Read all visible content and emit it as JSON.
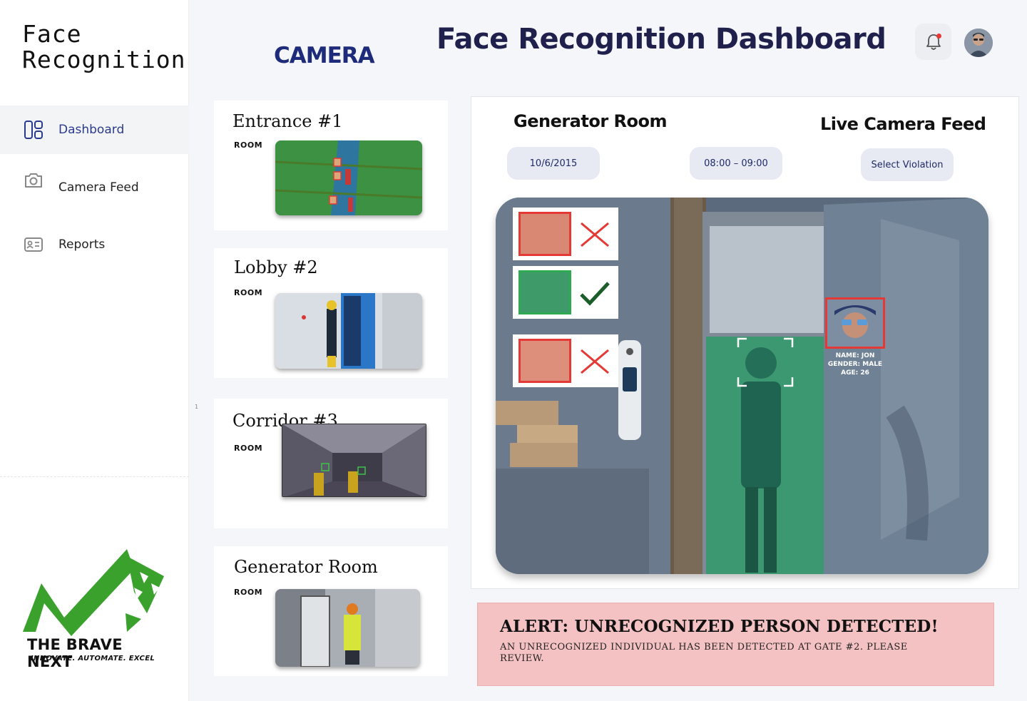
{
  "app": {
    "title_line1": "Face",
    "title_line2": "Recognition"
  },
  "sidebar": {
    "items": [
      {
        "label": "Dashboard",
        "icon": "dashboard-icon",
        "active": true
      },
      {
        "label": "Camera Feed",
        "icon": "camera-icon",
        "active": false
      },
      {
        "label": "Reports",
        "icon": "id-card-icon",
        "active": false
      }
    ],
    "stray_mark": "1",
    "logo": {
      "name": "THE BRAVE NEXT",
      "tagline": "INNOVATE. AUTOMATE. EXCEL",
      "color": "#3aa12c"
    }
  },
  "header": {
    "section": "CAMERA",
    "title": "Face Recognition Dashboard",
    "bell_icon": "bell-icon",
    "notification_dot_color": "#e53935"
  },
  "cameras": [
    {
      "name": "Entrance #1",
      "type": "ROOM"
    },
    {
      "name": "Lobby #2",
      "type": "ROOM"
    },
    {
      "name": "Corridor #3",
      "type": "ROOM"
    },
    {
      "name": "Generator Room",
      "type": "ROOM"
    }
  ],
  "live": {
    "room": "Generator Room",
    "heading": "Live Camera Feed",
    "date": "10/6/2015",
    "time_range": "08:00 – 09:00",
    "violation_select": "Select Violation",
    "detection": {
      "name_line": "NAME: JON",
      "gender_line": "GENDER: MALE",
      "age_line": "AGE: 26"
    },
    "face_checks": [
      "denied",
      "approved",
      "denied"
    ]
  },
  "alert": {
    "title": "ALERT: UNRECOGNIZED PERSON DETECTED!",
    "message": "An unrecognized individual has been detected at gate #2. Please review.",
    "bg_color": "#f5c2c4"
  }
}
